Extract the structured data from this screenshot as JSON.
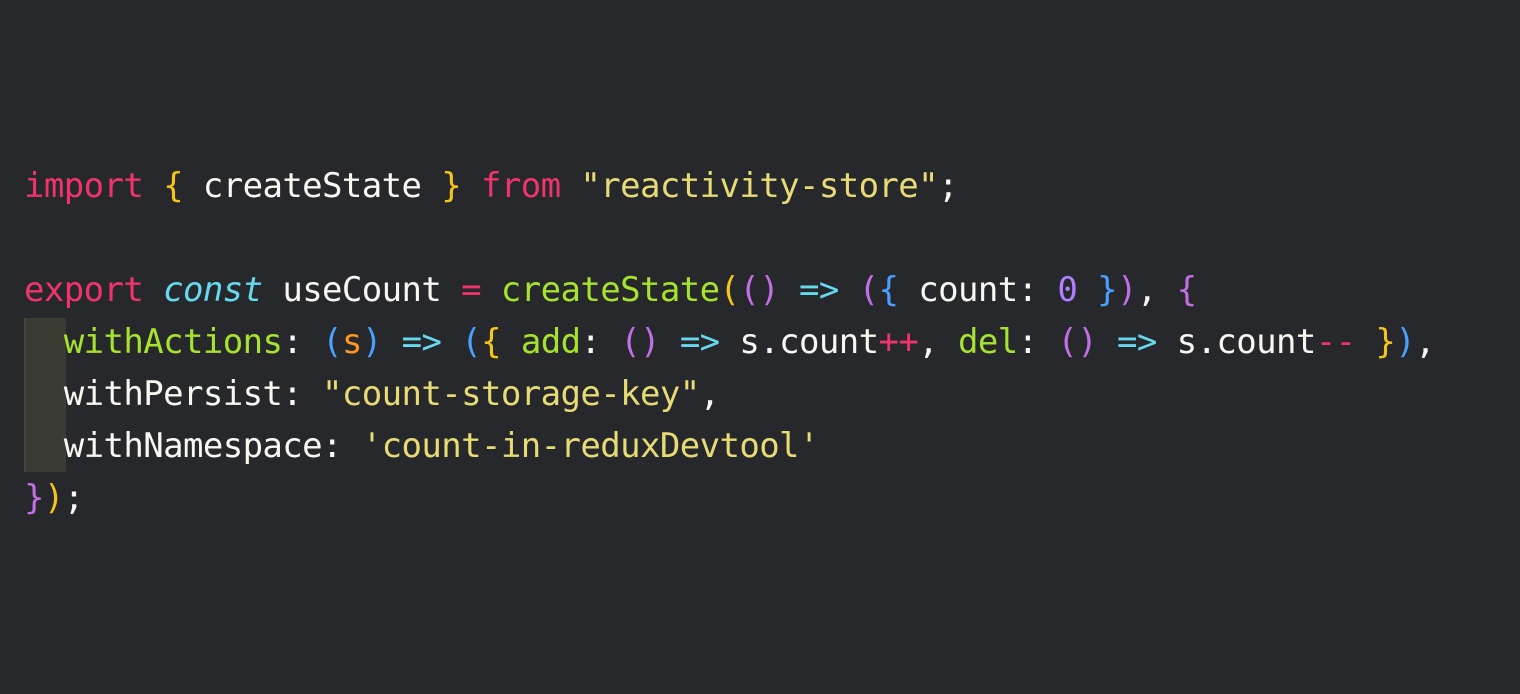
{
  "editor": {
    "lines": [
      [
        {
          "text": "import",
          "color": "#f0346b"
        },
        {
          "text": " ",
          "color": "#f8f8f2"
        },
        {
          "text": "{",
          "color": "#f5c518"
        },
        {
          "text": " createState ",
          "color": "#f8f8f2"
        },
        {
          "text": "}",
          "color": "#f5c518"
        },
        {
          "text": " ",
          "color": "#f8f8f2"
        },
        {
          "text": "from",
          "color": "#f0346b"
        },
        {
          "text": " ",
          "color": "#f8f8f2"
        },
        {
          "text": "\"reactivity-store\"",
          "color": "#e6db74"
        },
        {
          "text": ";",
          "color": "#f8f8f2"
        }
      ],
      [],
      [
        {
          "text": "export",
          "color": "#f0346b"
        },
        {
          "text": " ",
          "color": "#f8f8f2"
        },
        {
          "text": "const",
          "color": "#66d9ef",
          "italic": true
        },
        {
          "text": " useCount ",
          "color": "#f8f8f2"
        },
        {
          "text": "=",
          "color": "#f0346b"
        },
        {
          "text": " ",
          "color": "#f8f8f2"
        },
        {
          "text": "createState",
          "color": "#a6e22e"
        },
        {
          "text": "(",
          "color": "#f5c518"
        },
        {
          "text": "()",
          "color": "#c36ee6"
        },
        {
          "text": " ",
          "color": "#f8f8f2"
        },
        {
          "text": "=>",
          "color": "#66d9ef"
        },
        {
          "text": " ",
          "color": "#f8f8f2"
        },
        {
          "text": "(",
          "color": "#c36ee6"
        },
        {
          "text": "{",
          "color": "#4aa0ff"
        },
        {
          "text": " count: ",
          "color": "#f8f8f2"
        },
        {
          "text": "0",
          "color": "#ae81ff"
        },
        {
          "text": " ",
          "color": "#f8f8f2"
        },
        {
          "text": "}",
          "color": "#4aa0ff"
        },
        {
          "text": ")",
          "color": "#c36ee6"
        },
        {
          "text": ", ",
          "color": "#f8f8f2"
        },
        {
          "text": "{",
          "color": "#c36ee6"
        }
      ],
      [
        {
          "text": "  ",
          "color": "#f8f8f2"
        },
        {
          "text": "withActions",
          "color": "#a6e22e"
        },
        {
          "text": ": ",
          "color": "#f8f8f2"
        },
        {
          "text": "(",
          "color": "#4aa0ff"
        },
        {
          "text": "s",
          "color": "#fd971f"
        },
        {
          "text": ")",
          "color": "#4aa0ff"
        },
        {
          "text": " ",
          "color": "#f8f8f2"
        },
        {
          "text": "=>",
          "color": "#66d9ef"
        },
        {
          "text": " ",
          "color": "#f8f8f2"
        },
        {
          "text": "(",
          "color": "#4aa0ff"
        },
        {
          "text": "{",
          "color": "#f5c518"
        },
        {
          "text": " ",
          "color": "#f8f8f2"
        },
        {
          "text": "add",
          "color": "#a6e22e"
        },
        {
          "text": ": ",
          "color": "#f8f8f2"
        },
        {
          "text": "()",
          "color": "#c36ee6"
        },
        {
          "text": " ",
          "color": "#f8f8f2"
        },
        {
          "text": "=>",
          "color": "#66d9ef"
        },
        {
          "text": " s.count",
          "color": "#f8f8f2"
        },
        {
          "text": "++",
          "color": "#f0346b"
        },
        {
          "text": ", ",
          "color": "#f8f8f2"
        },
        {
          "text": "del",
          "color": "#a6e22e"
        },
        {
          "text": ": ",
          "color": "#f8f8f2"
        },
        {
          "text": "()",
          "color": "#c36ee6"
        },
        {
          "text": " ",
          "color": "#f8f8f2"
        },
        {
          "text": "=>",
          "color": "#66d9ef"
        },
        {
          "text": " s.count",
          "color": "#f8f8f2"
        },
        {
          "text": "--",
          "color": "#f0346b"
        },
        {
          "text": " ",
          "color": "#f8f8f2"
        },
        {
          "text": "}",
          "color": "#f5c518"
        },
        {
          "text": ")",
          "color": "#4aa0ff"
        },
        {
          "text": ",",
          "color": "#f8f8f2"
        }
      ],
      [
        {
          "text": "  withPersist: ",
          "color": "#f8f8f2"
        },
        {
          "text": "\"count-storage-key\"",
          "color": "#e6db74"
        },
        {
          "text": ",",
          "color": "#f8f8f2"
        }
      ],
      [
        {
          "text": "  withNamespace: ",
          "color": "#f8f8f2"
        },
        {
          "text": "'count-in-reduxDevtool'",
          "color": "#e6db74"
        }
      ],
      [
        {
          "text": "}",
          "color": "#c36ee6"
        },
        {
          "text": ")",
          "color": "#f5c518"
        },
        {
          "text": ";",
          "color": "#f8f8f2"
        }
      ]
    ]
  }
}
